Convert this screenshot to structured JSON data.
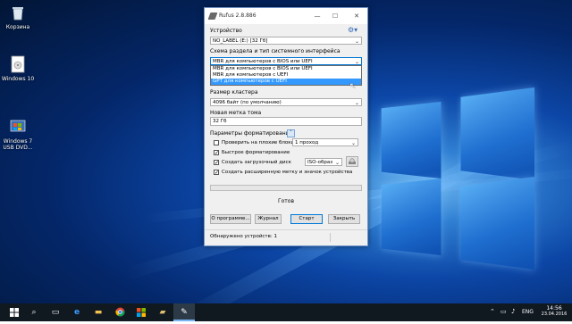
{
  "desktop": {
    "icons": [
      {
        "label": "Корзина",
        "icon": "recycle-bin-icon"
      },
      {
        "label": "Windows 10",
        "icon": "disc-image-icon"
      },
      {
        "label": "Windows 7\nUSB DVD...",
        "icon": "usb-dvd-tool-icon"
      }
    ]
  },
  "window": {
    "title": "Rufus 2.8.886",
    "device_label": "Устройство",
    "device_value": "NO_LABEL (E:) [32 Гб]",
    "partition_label": "Схема раздела и тип системного интерфейса",
    "partition_value": "MBR для компьютеров с BIOS или UEFI",
    "partition_options": [
      "MBR для компьютеров с BIOS или UEFI",
      "MBR для компьютеров с UEFI",
      "GPT для компьютеров с UEFI"
    ],
    "cluster_label": "Размер кластера",
    "cluster_value": "4096 байт (по умолчанию)",
    "volume_label": "Новая метка тома",
    "volume_value": "32 Гб",
    "format_options_label": "Параметры форматирования",
    "check_bad_blocks": "Проверить на плохие блоки",
    "passes_value": "1 проход",
    "quick_format": "Быстрое форматирование",
    "create_bootable": "Создать загрузочный диск",
    "image_type": "ISO-образ",
    "extended_label": "Создать расширенную метку и значок устройства",
    "status": "Готов",
    "about_button": "О программе...",
    "log_button": "Журнал",
    "start_button": "Старт",
    "close_button": "Закрыть",
    "footer": "Обнаружено устройств: 1"
  },
  "taskbar": {
    "language": "ENG",
    "time": "14:56",
    "date": "23.04.2016"
  }
}
